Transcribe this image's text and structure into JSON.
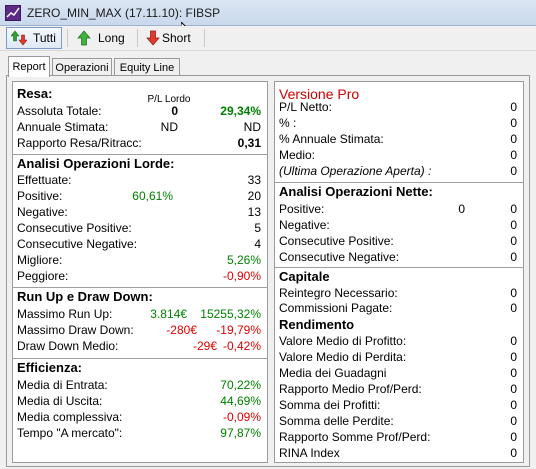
{
  "window": {
    "title": "ZERO_MIN_MAX (17.11.10): FIBSP"
  },
  "toolbar": {
    "buttons": [
      {
        "label": "Tutti"
      },
      {
        "label": "Long"
      },
      {
        "label": "Short"
      }
    ]
  },
  "tabs": [
    {
      "label": "Report"
    },
    {
      "label": "Operazioni"
    },
    {
      "label": "Equity Line"
    }
  ],
  "resa": {
    "title": "Resa:",
    "pl_header": "P/L Lordo",
    "rows": [
      {
        "label": "Assoluta Totale:",
        "v1": "0",
        "v2": "29,34%"
      },
      {
        "label": "Annuale Stimata:",
        "v1": "ND",
        "v2": "ND"
      },
      {
        "label": "Rapporto Resa/Ritracc:",
        "v2": "0,31"
      }
    ]
  },
  "lorde": {
    "title": "Analisi Operazioni Lorde:",
    "rows": [
      {
        "label": "Effettuate:",
        "v2": "33"
      },
      {
        "label": "Positive:",
        "v1": "60,61%",
        "v2": "20"
      },
      {
        "label": "Negative:",
        "v2": "13"
      },
      {
        "label": "Consecutive Positive:",
        "v2": "5"
      },
      {
        "label": "Consecutive Negative:",
        "v2": "4"
      },
      {
        "label": "Migliore:",
        "v2": "5,26%"
      },
      {
        "label": "Peggiore:",
        "v2": "-0,90%"
      }
    ]
  },
  "runup": {
    "title": "Run Up e Draw Down:",
    "rows": [
      {
        "label": "Massimo Run Up:",
        "v1": "3.814€",
        "v2": "15255,32%"
      },
      {
        "label": "Massimo Draw Down:",
        "v1": "-280€",
        "v2": "-19,79%"
      },
      {
        "label": "Draw Down Medio:",
        "v1": "-29€",
        "v2": "-0,42%"
      }
    ]
  },
  "efficienza": {
    "title": "Efficienza:",
    "rows": [
      {
        "label": "Media di Entrata:",
        "v2": "70,22%"
      },
      {
        "label": "Media di Uscita:",
        "v2": "44,69%"
      },
      {
        "label": "Media complessiva:",
        "v2": "-0,09%"
      },
      {
        "label": "Tempo \"A mercato\":",
        "v2": "97,87%"
      }
    ]
  },
  "pro": {
    "title": "Versione Pro",
    "rows": [
      {
        "label": "P/L Netto:",
        "v": "0"
      },
      {
        "label": "% :",
        "v": "0"
      },
      {
        "label": "% Annuale Stimata:",
        "v": "0"
      },
      {
        "label": "Medio:",
        "v": "0"
      },
      {
        "label": "(Ultima Operazione Aperta) :",
        "v": "0"
      }
    ]
  },
  "nette": {
    "title": "Analisi Operazioni Nette:",
    "rows": [
      {
        "label": "Positive:",
        "v1": "0",
        "v": "0"
      },
      {
        "label": "Negative:",
        "v": "0"
      },
      {
        "label": "Consecutive Positive:",
        "v": "0"
      },
      {
        "label": "Consecutive Negative:",
        "v": "0"
      }
    ]
  },
  "capitale": {
    "title": "Capitale",
    "rows": [
      {
        "label": "Reintegro Necessario:",
        "v": "0"
      },
      {
        "label": "Commissioni Pagate:",
        "v": "0"
      }
    ]
  },
  "rendimento": {
    "title": "Rendimento",
    "rows": [
      {
        "label": "Valore Medio di Profitto:",
        "v": "0"
      },
      {
        "label": "Valore Medio di Perdita:",
        "v": "0"
      },
      {
        "label": "Media dei Guadagni",
        "v": "0"
      },
      {
        "label": "Rapporto Medio Prof/Perd:",
        "v": "0"
      },
      {
        "label": "Somma dei Profitti:",
        "v": "0"
      },
      {
        "label": "Somma delle Perdite:",
        "v": "0"
      },
      {
        "label": "Rapporto Somme Prof/Perd:",
        "v": "0"
      },
      {
        "label": "RINA Index",
        "v": "0"
      }
    ]
  },
  "colors": {
    "positive": "#008000",
    "negative": "#e00000",
    "pro": "#cc0000"
  }
}
